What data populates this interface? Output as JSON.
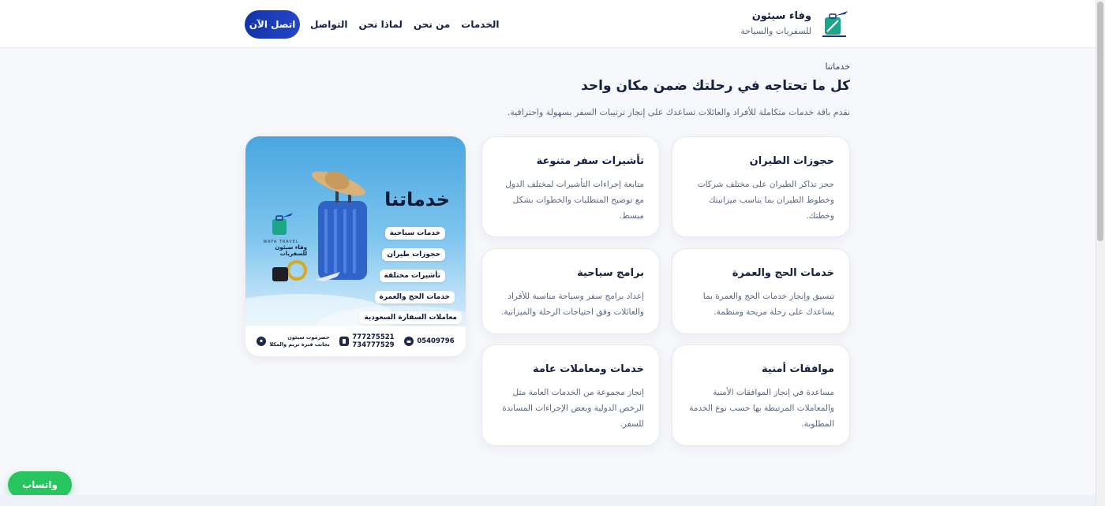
{
  "header": {
    "brand_name": "وفاء سيئون",
    "brand_sub": "للسفريات والسياحة",
    "nav": {
      "services": "الخدمات",
      "about": "من نحن",
      "why_us": "لماذا نحن",
      "contact": "التواصل"
    },
    "cta_label": "اتصل الآن"
  },
  "section": {
    "eyebrow": "خدماتنا",
    "title": "كل ما تحتاجه في رحلتك ضمن مكان واحد",
    "description": "نقدم باقة خدمات متكاملة للأفراد والعائلات تساعدك على إنجاز ترتيبات السفر بسهولة واحترافية."
  },
  "cards": [
    {
      "title": "حجوزات الطيران",
      "description": "حجز تذاكر الطيران على مختلف شركات وخطوط الطيران بما يناسب ميزانيتك وخطتك."
    },
    {
      "title": "تأشيرات سفر متنوعة",
      "description": "متابعة إجراءات التأشيرات لمختلف الدول مع توضيح المتطلبات والخطوات بشكل مبسط."
    },
    {
      "title": "خدمات الحج والعمرة",
      "description": "تنسيق وإنجاز خدمات الحج والعمرة بما يساعدك على رحلة مريحة ومنظمة."
    },
    {
      "title": "برامج سياحية",
      "description": "إعداد برامج سفر وسياحة مناسبة للأفراد والعائلات وفق احتياجات الرحلة والميزانية."
    },
    {
      "title": "موافقات أمنية",
      "description": "مساعدة في إنجاز الموافقات الأمنية والمعاملات المرتبطة بها حسب نوع الخدمة المطلوبة."
    },
    {
      "title": "خدمات ومعاملات عامة",
      "description": "إنجاز مجموعة من الخدمات العامة مثل الرخص الدولية وبعض الإجراءات المساندة للسفر."
    }
  ],
  "promo": {
    "heading": "خدماتنا",
    "items": [
      "خدمات سياحية",
      "حجوزات طيران",
      "تأشيرات مختلفة",
      "خدمات الحج والعمرة",
      "معاملات السفارة السعودية"
    ],
    "brand_en": "WAFA TRAVEL",
    "brand_ar": "وفاء سيئون للسفريات",
    "location_line1": "حضرموت سيئون",
    "location_line2": "بجانب فنزة تريم والمكلا",
    "phone_mobile1": "777275521",
    "phone_mobile2": "734777529",
    "phone_landline": "05409796"
  },
  "whatsapp_label": "واتساب",
  "colors": {
    "primary": "#1e3bb8",
    "whatsapp": "#28c45e",
    "text_dark": "#13203f",
    "text_muted": "#5c6680"
  }
}
